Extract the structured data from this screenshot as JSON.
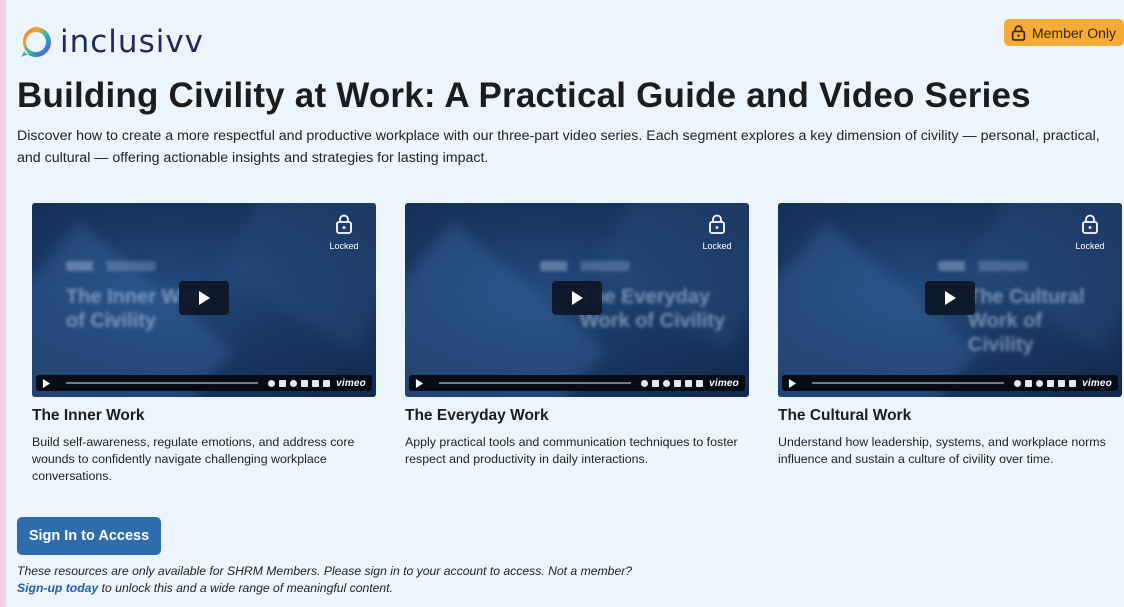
{
  "brand": {
    "name": "inclusivv",
    "logo_icon": "speech-bubble-rainbow-icon"
  },
  "badge": {
    "label": "Member Only",
    "icon": "lock-icon",
    "color": "#f6ab34"
  },
  "page": {
    "title": "Building Civility at Work: A Practical Guide and Video Series",
    "intro": "Discover how to create a more respectful and productive workplace with our three-part video series. Each segment explores a key dimension of civility — personal, practical, and cultural — offering actionable insights and strategies for lasting impact."
  },
  "videos": [
    {
      "title": "The Inner Work",
      "description": "Build self-awareness, regulate emotions, and address core wounds to confidently navigate challenging workplace conversations.",
      "thumb_text": "The Inner Work of Civility",
      "lock_label": "Locked",
      "player_brand": "vimeo"
    },
    {
      "title": "The Everyday Work",
      "description": "Apply practical tools and communication techniques to foster respect and productivity in daily interactions.",
      "thumb_text": "The Everyday Work of Civility",
      "lock_label": "Locked",
      "player_brand": "vimeo"
    },
    {
      "title": "The Cultural Work",
      "description": "Understand how leadership, systems, and workplace norms influence and sustain a culture of civility over time.",
      "thumb_text": "The Cultural Work of Civility",
      "lock_label": "Locked",
      "player_brand": "vimeo"
    }
  ],
  "access": {
    "button_label": "Sign In to Access",
    "note_text": "These resources are only available for SHRM Members. Please sign in to your account to access. Not a member?",
    "signup_link": "Sign-up today",
    "signup_suffix": " to unlock this and a wide range of meaningful content."
  },
  "colors": {
    "accent": "#2f6cab",
    "link": "#1f5fa8",
    "background": "#edf5fc"
  }
}
